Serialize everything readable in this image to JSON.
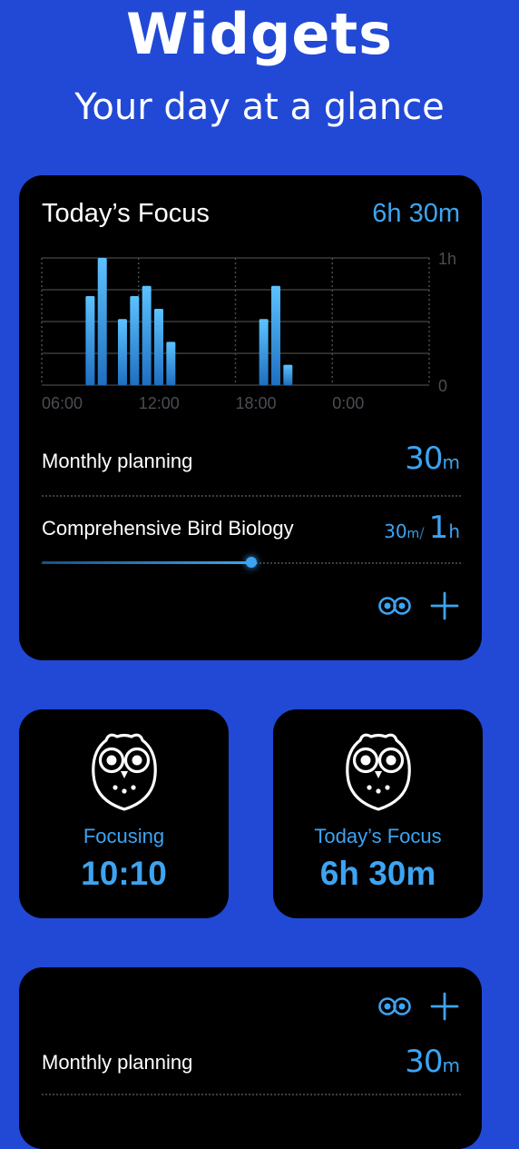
{
  "header": {
    "title": "Widgets",
    "subtitle": "Your day at a glance"
  },
  "main_widget": {
    "title": "Today’s Focus",
    "total": "6h 30m",
    "chart_data": {
      "type": "bar",
      "x_ticks": [
        "06:00",
        "12:00",
        "18:00",
        "0:00"
      ],
      "y_ticks": [
        "1h",
        "0"
      ],
      "ylim": [
        0,
        1
      ],
      "x": [
        9.0,
        9.75,
        11.0,
        11.75,
        12.5,
        13.25,
        14.0,
        19.75,
        20.5,
        21.25
      ],
      "values": [
        0.7,
        1.0,
        0.52,
        0.7,
        0.78,
        0.6,
        0.34,
        0.52,
        0.78,
        0.16
      ],
      "grid": true
    },
    "row1": {
      "label": "Monthly planning",
      "value": "30",
      "unit": "m"
    },
    "row2": {
      "label": "Comprehensive Bird Biology",
      "done": "30",
      "done_unit": "m",
      "sep": "/",
      "goal": "1",
      "goal_unit": "h",
      "progress": 0.5
    }
  },
  "small_left": {
    "label": "Focusing",
    "value": "10:10"
  },
  "small_right": {
    "label": "Today’s Focus",
    "value": "6h 30m"
  },
  "bottom_widget": {
    "row1": {
      "label": "Monthly planning",
      "value": "30",
      "unit": "m"
    }
  },
  "colors": {
    "background": "#2149D6",
    "card": "#000000",
    "accent": "#3DA4F2"
  }
}
